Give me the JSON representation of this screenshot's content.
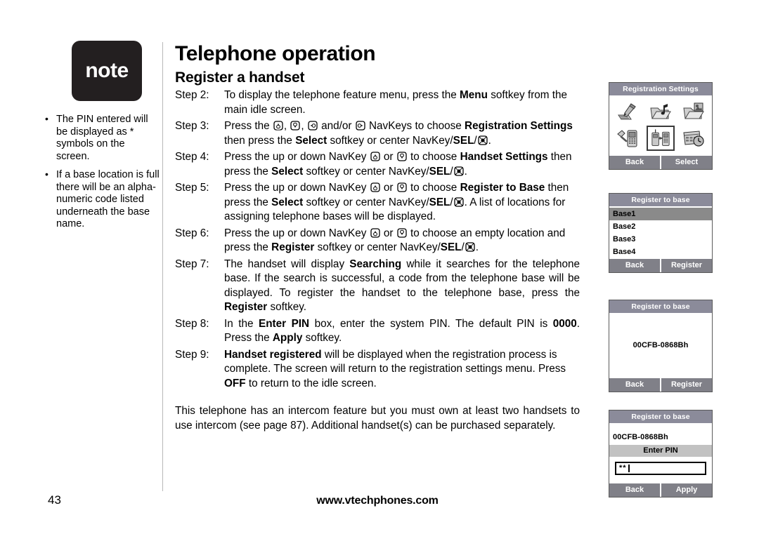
{
  "note": {
    "badge_label": "note",
    "bullets": [
      "The PIN entered will be displayed as * symbols on the screen.",
      "If a base location is full there will be an alpha-numeric code listed underneath the base name."
    ]
  },
  "main": {
    "page_title": "Telephone operation",
    "section_title": "Register a handset",
    "steps": [
      {
        "label": "Step 2:"
      },
      {
        "label": "Step 3:"
      },
      {
        "label": "Step 4:"
      },
      {
        "label": "Step 5:"
      },
      {
        "label": "Step 6:"
      },
      {
        "label": "Step 7:"
      },
      {
        "label": "Step 8:"
      },
      {
        "label": "Step 9:"
      }
    ],
    "step2_text": {
      "a": "To display the telephone feature menu, press the ",
      "b_menu": "Menu",
      "c": " softkey from the main idle screen."
    },
    "step3_text": {
      "a": "Press the ",
      "b": ", ",
      "c": ", ",
      "d": " and/or ",
      "e": " NavKeys to choose ",
      "f_registration": "Registration Settings",
      "g": " then press the ",
      "h_select": "Select",
      "i": " softkey or center NavKey/",
      "j_sel": "SEL",
      "k": "/",
      "l": "."
    },
    "step4_text": {
      "a": "Press the up or down NavKey ",
      "b": " or ",
      "c": " to choose ",
      "d_handset": "Handset Settings",
      "e": " then press the ",
      "f_select": "Select",
      "g": " softkey or center NavKey/",
      "h_sel": "SEL",
      "i": "/",
      "j": "."
    },
    "step5_text": {
      "a": "Press the up or down NavKey ",
      "b": " or ",
      "c": " to choose ",
      "d_register": "Register to Base",
      "e": " then press the ",
      "f_select": "Select",
      "g": " softkey or center NavKey/",
      "h_sel": "SEL",
      "i": "/",
      "j": ". A list of locations for assigning telephone bases will be displayed."
    },
    "step6_text": {
      "a": "Press the up or down NavKey ",
      "b": " or ",
      "c": " to choose an empty location and press the ",
      "d_register": "Register",
      "e": " softkey or center NavKey/",
      "f_sel": "SEL",
      "g": "/",
      "h": "."
    },
    "step7_text": {
      "a": "The handset will display ",
      "b_searching": "Searching",
      "c": " while it searches for the telephone base. If the search is successful, a code from the telephone base will be displayed. To register the handset to the telephone base, press the ",
      "d_register": "Register",
      "e": " softkey."
    },
    "step8_text": {
      "a": "In the ",
      "b_enterpin": "Enter PIN",
      "c": " box, enter the system PIN. The default PIN is ",
      "d_pin": "0000",
      "e": ". Press the ",
      "f_apply": "Apply",
      "g": " softkey."
    },
    "step9_text": {
      "a_handset": "Handset registered",
      "b": " will be displayed when the registration process is complete. The screen will return to the registration settings menu. Press ",
      "c_off": "OFF",
      "d": " to return to the idle screen."
    },
    "closing_paragraph": "This telephone has an intercom feature but you must own at least two handsets to use intercom (see page 87). Additional handset(s) can be purchased separately."
  },
  "footer": {
    "page_number": "43",
    "url": "www.vtechphones.com"
  },
  "screens": [
    {
      "title": "Registration Settings",
      "icons": [
        "edit-settings-icon",
        "folder-music-icon",
        "folder-photo-icon",
        "handset-settings-icon",
        "registration-settings-icon",
        "clock-settings-icon"
      ],
      "selected_icon_index": 4,
      "softkeys": [
        "Back",
        "Select"
      ]
    },
    {
      "title": "Register to base",
      "list": [
        "Base1",
        "Base2",
        "Base3",
        "Base4"
      ],
      "selected_index": 0,
      "softkeys": [
        "Back",
        "Register"
      ]
    },
    {
      "title": "Register to base",
      "base_code": "00CFB-0868Bh",
      "softkeys": [
        "Back",
        "Register"
      ]
    },
    {
      "title": "Register to base",
      "base_code": "00CFB-0868Bh",
      "pin_label": "Enter PIN",
      "pin_value": "**",
      "softkeys": [
        "Back",
        "Apply"
      ]
    }
  ],
  "colors": {
    "note_badge": "#231f20",
    "screen_title_bar": "#8b8b9a",
    "softkey": "#808088",
    "list_selected": "#8a8a8a",
    "pin_bar": "#c2c2c2"
  }
}
